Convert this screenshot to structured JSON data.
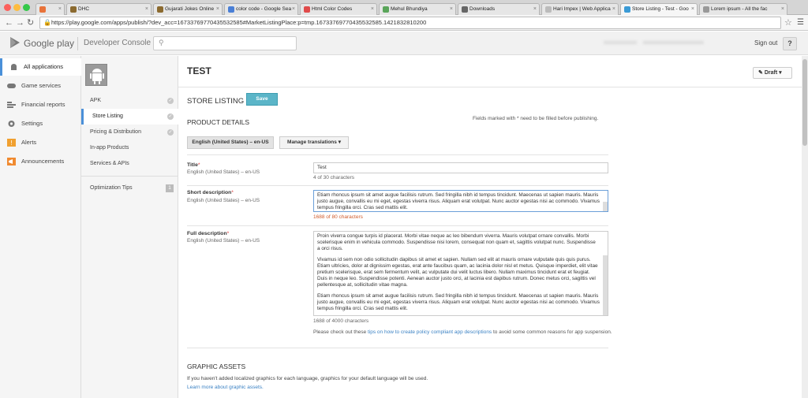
{
  "browser": {
    "tabs": [
      {
        "title": "",
        "active": false,
        "color": "#e8733a"
      },
      {
        "title": "DHC",
        "active": false,
        "color": "#8b6a2f"
      },
      {
        "title": "Gujarati Jokes Online",
        "active": false,
        "color": "#8b6a2f"
      },
      {
        "title": "color code - Google Sea",
        "active": false,
        "color": "#4a7fd6"
      },
      {
        "title": "Html Color Codes",
        "active": false,
        "color": "#e04b4b"
      },
      {
        "title": "Mehul Bhundiya",
        "active": false,
        "color": "#5aa55a"
      },
      {
        "title": "Downloads",
        "active": false,
        "color": "#666666"
      },
      {
        "title": "Hari Impex | Web Applica",
        "active": false,
        "color": "#bbbbbb"
      },
      {
        "title": "Store Listing - Test - Goo",
        "active": true,
        "color": "#3b9bd6"
      },
      {
        "title": "Lorem ipsum - All the fac",
        "active": false,
        "color": "#999999"
      }
    ],
    "url": "https://play.google.com/apps/publish/?dev_acc=16733769770435532585#MarketListingPlace:p=tmp.16733769770435532585.1421832810200"
  },
  "header": {
    "brand": "Google play",
    "console": "Developer Console",
    "sign_out": "Sign out",
    "help": "?"
  },
  "sidebar": {
    "items": [
      {
        "label": "All applications",
        "icon": "android-icon",
        "active": true
      },
      {
        "label": "Game services",
        "icon": "gamepad-icon",
        "active": false
      },
      {
        "label": "Financial reports",
        "icon": "reports-icon",
        "active": false
      },
      {
        "label": "Settings",
        "icon": "gear-icon",
        "active": false
      },
      {
        "label": "Alerts",
        "icon": "alert-icon",
        "active": false
      },
      {
        "label": "Announcements",
        "icon": "announcement-icon",
        "active": false
      }
    ]
  },
  "subnav": {
    "items": [
      {
        "label": "APK",
        "check": true,
        "active": false
      },
      {
        "label": "Store Listing",
        "check": true,
        "active": true
      },
      {
        "label": "Pricing & Distribution",
        "check": true,
        "active": false
      },
      {
        "label": "In-app Products",
        "check": false,
        "active": false
      },
      {
        "label": "Services & APIs",
        "check": false,
        "active": false
      }
    ],
    "optimization": {
      "label": "Optimization Tips",
      "count": "1"
    }
  },
  "main": {
    "app_title": "TEST",
    "draft_label": "Draft",
    "store_listing": "STORE LISTING",
    "save": "Save",
    "product_details": "PRODUCT DETAILS",
    "required_note": "Fields marked with * need to be filled before publishing.",
    "lang_button": "English (United States) – en-US",
    "manage_translations": "Manage translations",
    "fields": {
      "title": {
        "label": "Title",
        "lang": "English (United States) – en-US",
        "value": "Test",
        "count": "4 of 30 characters"
      },
      "short": {
        "label": "Short description",
        "lang": "English (United States) – en-US",
        "count": "1688 of 80 characters",
        "text": "Etiam rhoncus ipsum sit amet augue facilisis rutrum. Sed fringilla nibh id tempus tincidunt. Maecenas ut sapien mauris. Mauris justo augue, convallis eu mi eget, egestas viverra risus. Aliquam erat volutpat. Nunc auctor egestas nisi ac commodo. Vivamus tempus fringilla orci. Cras sed mattis elit."
      },
      "full": {
        "label": "Full description",
        "lang": "English (United States) – en-US",
        "count": "1688 of 4000 characters",
        "paragraphs": [
          "Proin viverra congue turpis id placerat. Morbi vitae neque ac leo bibendum viverra. Mauris volutpat ornare convallis. Morbi scelerisque enim in vehicula commodo. Suspendisse nisi lorem, consequat non quam et, sagittis volutpat nunc. Suspendisse a orci risus.",
          "Vivamus id sem non odio sollicitudin dapibus sit amet et sapien. Nullam sed elit at mauris ornare vulputate quis quis purus. Etiam ultricies, dolor at dignissim egestas, erat ante faucibus quam, ac lacinia dolor nisl et metus. Quisque imperdiet, elit vitae pretium scelerisque, erat sem fermentum velit, ac vulputate dui velit luctus libero. Nullam maximus tincidunt erat et feugiat. Duis in neque leo. Suspendisse potenti. Aenean auctor justo orci, at lacinia est dapibus rutrum. Donec metus orci, sagittis vel pellentesque at, sollicitudin vitae magna.",
          "Etiam rhoncus ipsum sit amet augue facilisis rutrum. Sed fringilla nibh id tempus tincidunt. Maecenas ut sapien mauris. Mauris justo augue, convallis eu mi eget, egestas viverra risus. Aliquam erat volutpat. Nunc auctor egestas nisi ac commodo. Vivamus tempus fringilla orci. Cras sed mattis elit."
        ]
      }
    },
    "policy_before": "Please check out these ",
    "policy_link": "tips on how to create policy compliant app descriptions",
    "policy_after": " to avoid some common reasons for app suspension.",
    "graphic_assets": "GRAPHIC ASSETS",
    "graphic_note": "If you haven't added localized graphics for each language, graphics for your default language will be used.",
    "graphic_link": "Learn more about graphic assets."
  }
}
